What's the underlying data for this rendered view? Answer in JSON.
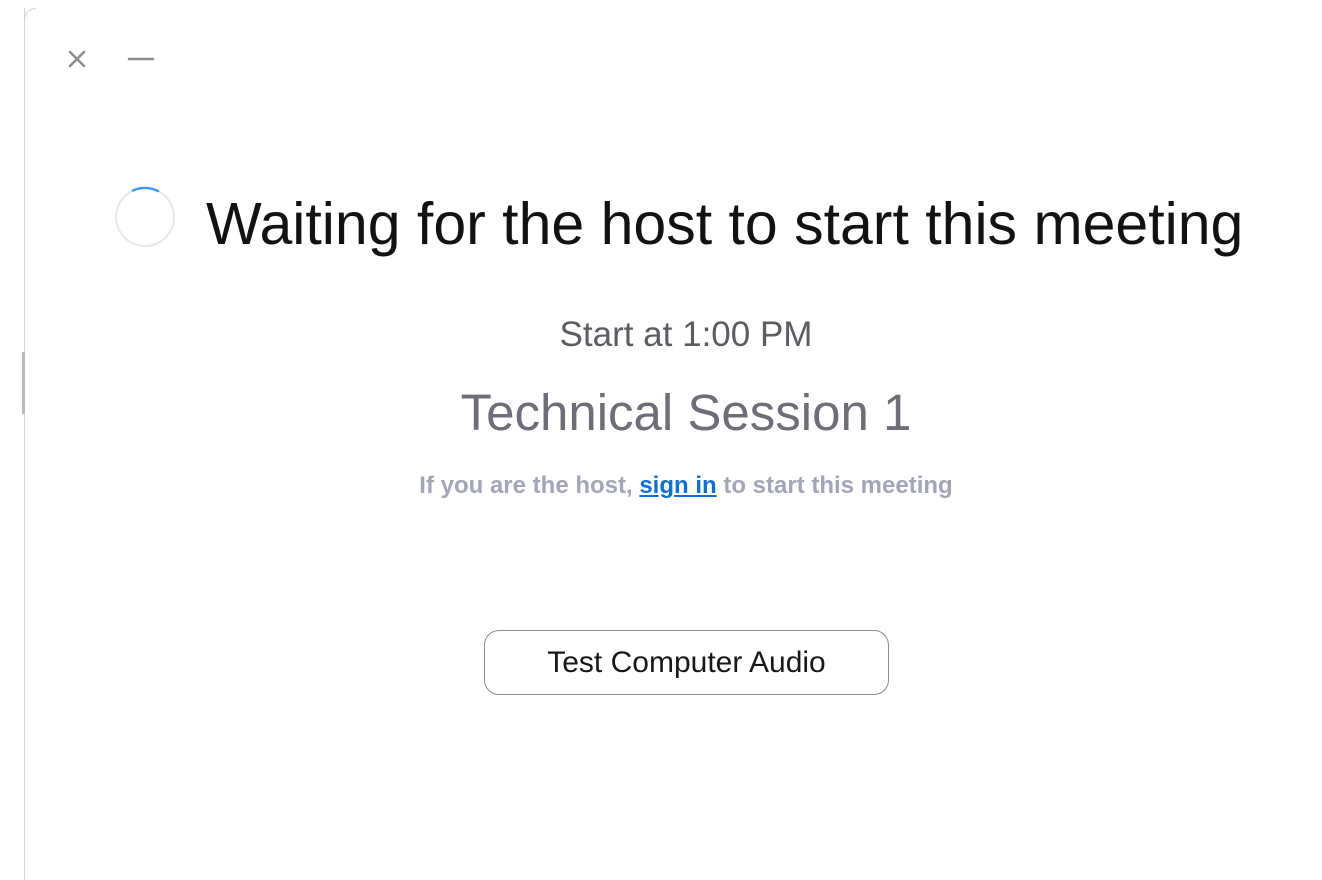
{
  "window": {
    "close_icon": "close-icon",
    "minimize_icon": "minimize-icon"
  },
  "main": {
    "spinner_icon": "loading-spinner-icon",
    "headline": "Waiting for the host to start this meeting",
    "start_time": "Start at 1:00 PM",
    "meeting_title": "Technical Session 1",
    "host_note": {
      "prefix": "If you are the host, ",
      "link": "sign in",
      "suffix": " to start this meeting"
    },
    "test_audio_button": "Test Computer Audio"
  },
  "colors": {
    "background": "#ffffff",
    "headline": "#121214",
    "meeting_title": "#6e6e78",
    "secondary_text": "#a3a6b8",
    "link": "#0e6fd8",
    "spinner_accent": "#3a9af2",
    "button_border": "#8a8a90"
  }
}
